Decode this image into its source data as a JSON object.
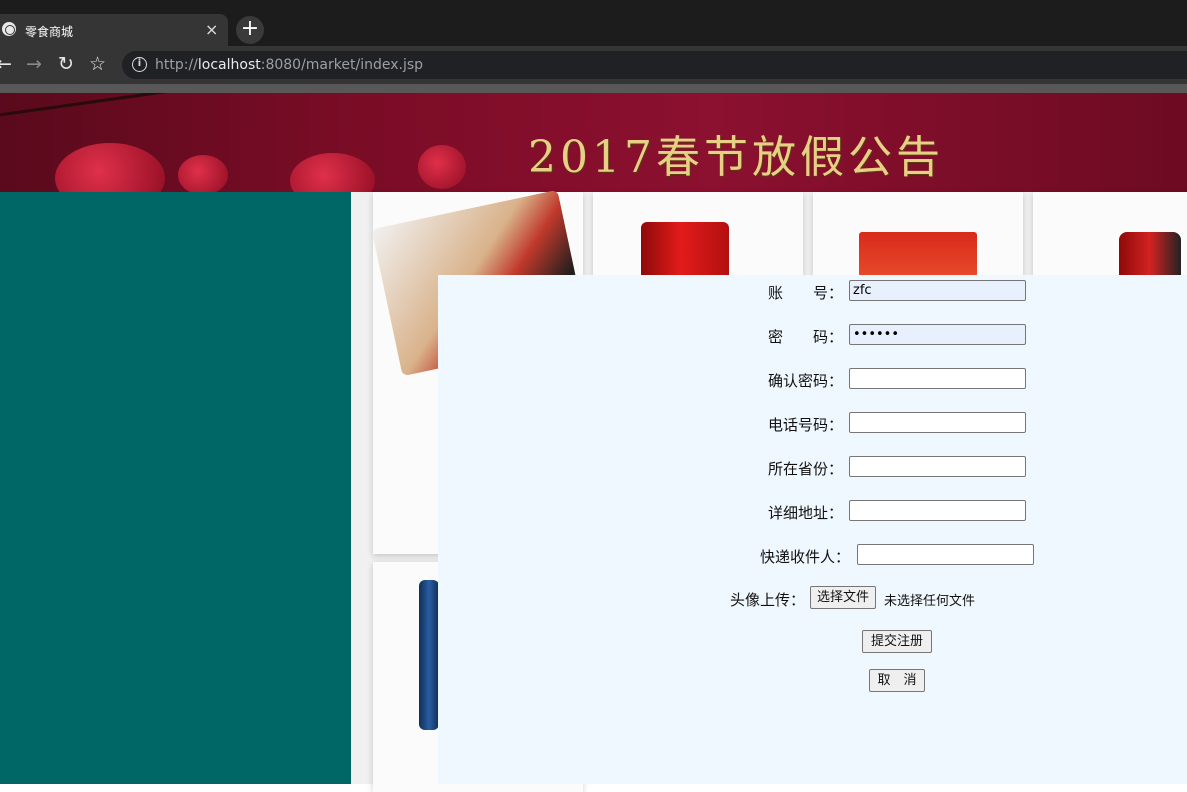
{
  "browser": {
    "tab_title": "零食商城",
    "tab_close": "×",
    "new_tab": "+",
    "url_scheme": "http://",
    "url_host": "localhost",
    "url_rest": ":8080/market/index.jsp"
  },
  "banner": {
    "headline": "2017春节放假公告"
  },
  "form": {
    "account_label": "账　　号：",
    "account_value": "zfc",
    "password_label": "密　　码：",
    "password_value": "••••••",
    "confirm_label": "确认密码：",
    "phone_label": "电话号码：",
    "province_label": "所在省份：",
    "address_label": "详细地址：",
    "receiver_label": "快递收件人：",
    "avatar_label": "头像上传：",
    "choose_file": "选择文件",
    "no_file": "未选择任何文件",
    "submit": "提交注册",
    "cancel": "取　消"
  },
  "colors": {
    "sidebar": "#006666",
    "dialog_bg": "#f0f8ff",
    "autofill": "#e8f0fe"
  }
}
